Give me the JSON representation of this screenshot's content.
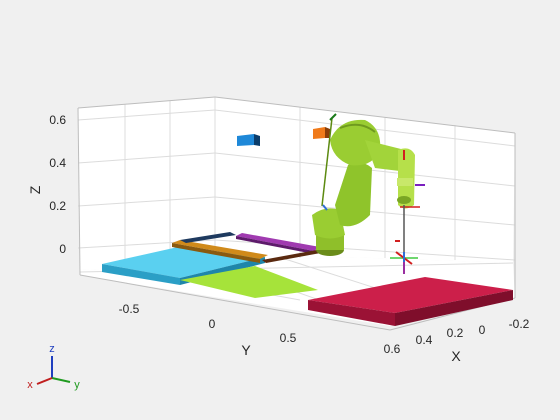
{
  "axes": {
    "x_label": "X",
    "y_label": "Y",
    "z_label": "Z",
    "x_ticks": [
      "0.6",
      "0.4",
      "0.2",
      "0",
      "-0.2"
    ],
    "y_ticks": [
      "-0.5",
      "0",
      "0.5"
    ],
    "z_ticks": [
      "0.6",
      "0.4",
      "0.2",
      "0"
    ]
  },
  "triad": {
    "x": "x",
    "y": "y",
    "z": "z"
  },
  "colors": {
    "background": "#f0f0f0",
    "robot": "#9acd32",
    "table_red": "#b5173e",
    "platform_cyan": "#4fc3e8",
    "platform_lime": "#a6e33a",
    "bar_purple": "#9a2fa0",
    "bar_orange": "#d08a1a",
    "bar_navy": "#1e3a5f",
    "box_blue": "#1e88d8",
    "box_orange": "#f07a1a"
  }
}
